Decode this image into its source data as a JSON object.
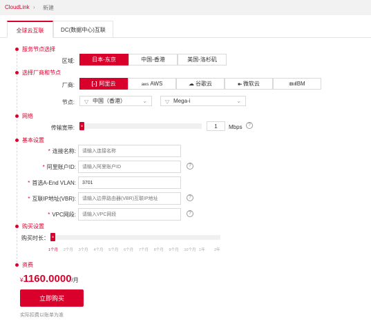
{
  "breadcrumb": {
    "brand": "CloudLink",
    "separator": "›",
    "page": "新建"
  },
  "tabs": [
    {
      "label": "全球云互联",
      "active": true
    },
    {
      "label": "DC(数据中心)互联",
      "active": false
    }
  ],
  "sections": {
    "service_node": "服务节点选择",
    "vendor_node": "选择厂商和节点",
    "network": "网络",
    "basic": "基本设置",
    "purchase": "购买设置",
    "fee": "资费"
  },
  "region": {
    "label": "区域:",
    "options": [
      "日本-东京",
      "中国-香港",
      "美国-洛杉矶"
    ],
    "selected": "日本-东京"
  },
  "vendor": {
    "label": "厂商:",
    "options": [
      {
        "icon": "aliyun-icon",
        "text": "阿里云",
        "glyph": "[-]"
      },
      {
        "icon": "aws-icon",
        "text": "AWS",
        "glyph": "aws"
      },
      {
        "icon": "google-cloud-icon",
        "text": "谷歌云",
        "glyph": "☁"
      },
      {
        "icon": "microsoft-icon",
        "text": "微软云",
        "glyph": "■▪"
      },
      {
        "icon": "ibm-icon",
        "text": "IBM",
        "glyph": "IBM"
      }
    ],
    "selected": "阿里云"
  },
  "node": {
    "label": "节点:",
    "select1": "中国（香港）",
    "select2": "Mega-i"
  },
  "bandwidth": {
    "label": "传输宽带:",
    "value": "1",
    "unit": "Mbps",
    "fraction": 0.0
  },
  "basic": {
    "fields": [
      {
        "label": "连接名称:",
        "placeholder": "请输入连接名称",
        "value": "",
        "help": false
      },
      {
        "label": "阿里账户ID:",
        "placeholder": "请输入阿里账户ID",
        "value": "",
        "help": true
      },
      {
        "label": "首选A-End VLAN:",
        "placeholder": "",
        "value": "3701",
        "help": false
      },
      {
        "label": "互联IP地址(VBR):",
        "placeholder": "请输入边界路由器(VBR)互联IP地址",
        "value": "",
        "help": true
      },
      {
        "label": "VPC网段:",
        "placeholder": "请输入VPC网段",
        "value": "",
        "help": true
      }
    ]
  },
  "purchase": {
    "label": "购买时长：",
    "ticks": [
      "1个月",
      "2个月",
      "3个月",
      "4个月",
      "5个月",
      "6个月",
      "7个月",
      "8个月",
      "9个月",
      "10个月",
      "1年",
      "2年"
    ],
    "selected_index": 0
  },
  "price": {
    "currency": "¥",
    "amount": "1160.0000",
    "period": "/月"
  },
  "buy_button": "立即购买",
  "note": "实际扣费以账单为准",
  "colors": {
    "accent": "#d9002b"
  }
}
